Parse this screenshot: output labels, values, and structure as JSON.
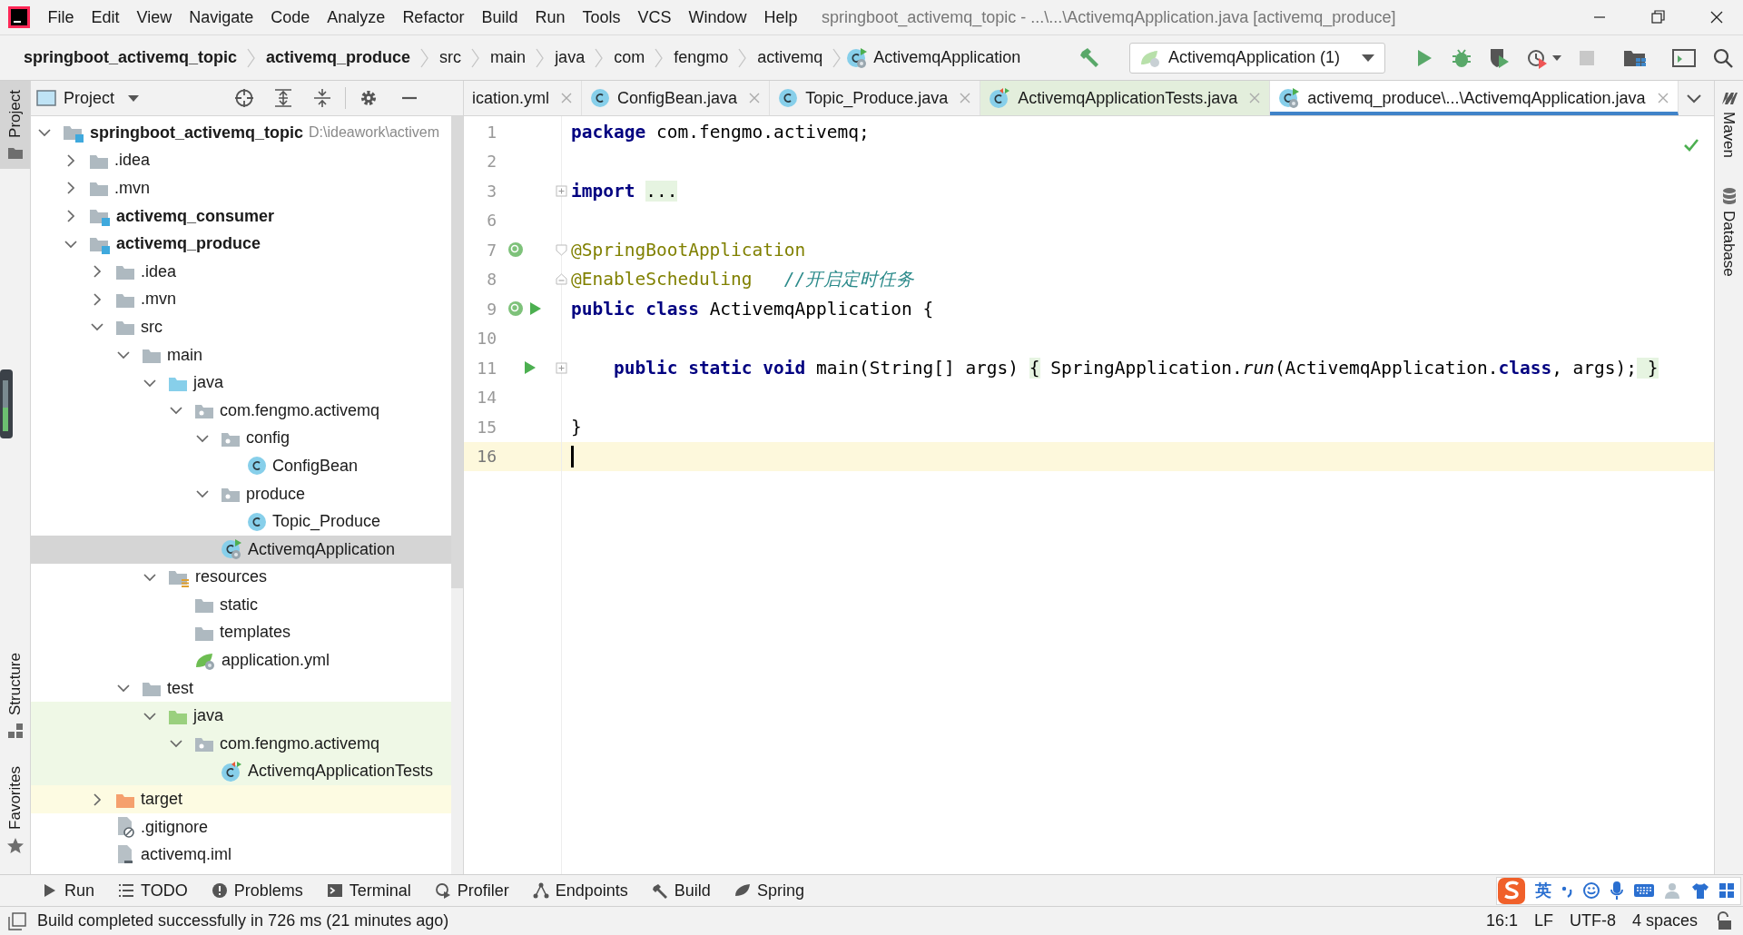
{
  "window": {
    "title": "springboot_activemq_topic - ...\\...\\ActivemqApplication.java [activemq_produce]",
    "menu": [
      "File",
      "Edit",
      "View",
      "Navigate",
      "Code",
      "Analyze",
      "Refactor",
      "Build",
      "Run",
      "Tools",
      "VCS",
      "Window",
      "Help"
    ]
  },
  "breadcrumbs": [
    {
      "label": "springboot_activemq_topic",
      "bold": true
    },
    {
      "label": "activemq_produce",
      "bold": true
    },
    {
      "label": "src",
      "bold": false
    },
    {
      "label": "main",
      "bold": false
    },
    {
      "label": "java",
      "bold": false
    },
    {
      "label": "com",
      "bold": false
    },
    {
      "label": "fengmo",
      "bold": false
    },
    {
      "label": "activemq",
      "bold": false
    },
    {
      "label": "ActivemqApplication",
      "bold": false,
      "kind": "spring-class"
    }
  ],
  "run_config": {
    "label": "ActivemqApplication (1)"
  },
  "left_strip": [
    {
      "label": "Project",
      "selected": true,
      "kind": "folder"
    },
    {
      "label": "Structure",
      "selected": false,
      "kind": "structure"
    },
    {
      "label": "Favorites",
      "selected": false,
      "kind": "star"
    }
  ],
  "right_strip": [
    {
      "label": "Maven",
      "kind": "maven"
    },
    {
      "label": "Database",
      "kind": "database"
    }
  ],
  "project_panel": {
    "title": "Project",
    "tree": [
      {
        "label": "springboot_activemq_topic",
        "path": "D:\\ideawork\\activem",
        "kind": "module",
        "bold": true,
        "expanded": true,
        "selected": false,
        "children": [
          {
            "label": ".idea",
            "kind": "folder",
            "expanded": false,
            "selected": false
          },
          {
            "label": ".mvn",
            "kind": "folder",
            "expanded": false,
            "selected": false
          },
          {
            "label": "activemq_consumer",
            "kind": "module",
            "bold": true,
            "expanded": false,
            "selected": false
          },
          {
            "label": "activemq_produce",
            "kind": "module",
            "bold": true,
            "expanded": true,
            "selected": false,
            "children": [
              {
                "label": ".idea",
                "kind": "folder",
                "expanded": false,
                "selected": false
              },
              {
                "label": ".mvn",
                "kind": "folder",
                "expanded": false,
                "selected": false
              },
              {
                "label": "src",
                "kind": "folder",
                "expanded": true,
                "selected": false,
                "children": [
                  {
                    "label": "main",
                    "kind": "folder",
                    "expanded": true,
                    "selected": false,
                    "children": [
                      {
                        "label": "java",
                        "kind": "source",
                        "expanded": true,
                        "selected": false,
                        "children": [
                          {
                            "label": "com.fengmo.activemq",
                            "kind": "package",
                            "expanded": true,
                            "selected": false,
                            "children": [
                              {
                                "label": "config",
                                "kind": "package",
                                "expanded": true,
                                "selected": false,
                                "children": [
                                  {
                                    "label": "ConfigBean",
                                    "kind": "class",
                                    "selected": false
                                  }
                                ]
                              },
                              {
                                "label": "produce",
                                "kind": "package",
                                "expanded": true,
                                "selected": false,
                                "children": [
                                  {
                                    "label": "Topic_Produce",
                                    "kind": "class",
                                    "selected": false
                                  }
                                ]
                              },
                              {
                                "label": "ActivemqApplication",
                                "kind": "spring-class",
                                "selected": true
                              }
                            ]
                          }
                        ]
                      },
                      {
                        "label": "resources",
                        "kind": "resources",
                        "expanded": true,
                        "selected": false,
                        "children": [
                          {
                            "label": "static",
                            "kind": "folder",
                            "selected": false
                          },
                          {
                            "label": "templates",
                            "kind": "folder",
                            "selected": false
                          },
                          {
                            "label": "application.yml",
                            "kind": "yml",
                            "selected": false
                          }
                        ]
                      }
                    ]
                  },
                  {
                    "label": "test",
                    "kind": "folder",
                    "expanded": true,
                    "selected": false,
                    "children": [
                      {
                        "label": "java",
                        "kind": "test-source",
                        "expanded": true,
                        "selected": false,
                        "test": true,
                        "children": [
                          {
                            "label": "com.fengmo.activemq",
                            "kind": "package",
                            "expanded": true,
                            "selected": false,
                            "test": true,
                            "children": [
                              {
                                "label": "ActivemqApplicationTests",
                                "kind": "test-class",
                                "selected": false,
                                "test": true
                              }
                            ]
                          }
                        ]
                      }
                    ]
                  }
                ]
              },
              {
                "label": "target",
                "kind": "excluded",
                "expanded": false,
                "selected": false,
                "excluded": true
              },
              {
                "label": ".gitignore",
                "kind": "gitignore",
                "selected": false
              },
              {
                "label": "activemq.iml",
                "kind": "iml",
                "selected": false
              }
            ]
          }
        ]
      }
    ]
  },
  "tabs": [
    {
      "label": "ication.yml",
      "selected": false
    },
    {
      "label": "ConfigBean.java",
      "kind": "class",
      "selected": false
    },
    {
      "label": "Topic_Produce.java",
      "kind": "class",
      "selected": false
    },
    {
      "label": "ActivemqApplicationTests.java",
      "kind": "test-class",
      "selected": false,
      "test": true
    },
    {
      "label": "activemq_produce\\...\\ActivemqApplication.java",
      "kind": "spring-class",
      "selected": true
    }
  ],
  "editor": {
    "lines": [
      {
        "number": "1",
        "current": false,
        "tokens": [
          {
            "kind": "keyword",
            "text": "package"
          },
          {
            "kind": "plain",
            "text": " com.fengmo.activemq;"
          }
        ]
      },
      {
        "number": "2",
        "current": false
      },
      {
        "number": "3",
        "current": false,
        "folded": true,
        "tokens": [
          {
            "kind": "keyword",
            "text": "import "
          },
          {
            "kind": "folded",
            "text": "..."
          }
        ]
      },
      {
        "number": "6",
        "current": false
      },
      {
        "number": "7",
        "current": false,
        "fold_start": true,
        "bean_marker": true,
        "tokens": [
          {
            "kind": "annotation",
            "text": "@SpringBootApplication"
          }
        ]
      },
      {
        "number": "8",
        "current": false,
        "fold_end": true,
        "tokens": [
          {
            "kind": "annotation",
            "text": "@EnableScheduling   "
          },
          {
            "kind": "comment",
            "text": "//开启定时任务"
          }
        ]
      },
      {
        "number": "9",
        "current": false,
        "bean_marker": true,
        "run_marker": true,
        "tokens": [
          {
            "kind": "keyword",
            "text": "public class"
          },
          {
            "kind": "plain",
            "text": " ActivemqApplication {"
          }
        ]
      },
      {
        "number": "10",
        "current": false
      },
      {
        "number": "11",
        "current": false,
        "folded": true,
        "run_marker": true,
        "tokens": [
          {
            "kind": "keyword",
            "text": "    public static void"
          },
          {
            "kind": "plain",
            "text": " main(String[] args) "
          },
          {
            "kind": "folded",
            "text": "{"
          },
          {
            "kind": "plain",
            "text": " SpringApplication."
          },
          {
            "kind": "italic",
            "text": "run"
          },
          {
            "kind": "plain",
            "text": "(ActivemqApplication."
          },
          {
            "kind": "keyword",
            "text": "class"
          },
          {
            "kind": "plain",
            "text": ", args);"
          },
          {
            "kind": "folded",
            "text": " }"
          }
        ]
      },
      {
        "number": "14",
        "current": false
      },
      {
        "number": "15",
        "current": false,
        "tokens": [
          {
            "kind": "plain",
            "text": "}"
          }
        ]
      },
      {
        "number": "16",
        "current": true
      }
    ]
  },
  "tool_buttons": [
    {
      "label": "Run",
      "kind": "run"
    },
    {
      "label": "TODO",
      "kind": "todo"
    },
    {
      "label": "Problems",
      "kind": "problems"
    },
    {
      "label": "Terminal",
      "kind": "terminal"
    },
    {
      "label": "Profiler",
      "kind": "profiler"
    },
    {
      "label": "Endpoints",
      "kind": "endpoints"
    },
    {
      "label": "Build",
      "kind": "build"
    },
    {
      "label": "Spring",
      "kind": "spring"
    }
  ],
  "ime_bar": {
    "mode": "英"
  },
  "status_bar": {
    "message": "Build completed successfully in 726 ms (21 minutes ago)",
    "items": [
      "16:1",
      "LF",
      "UTF-8",
      "4 spaces"
    ]
  }
}
